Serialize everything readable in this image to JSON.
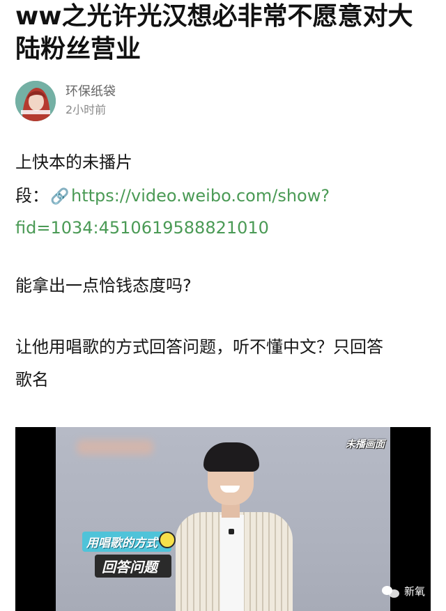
{
  "post": {
    "title": "ww之光许光汉想必非常不愿意对大陆粉丝营业",
    "author": "环保纸袋",
    "time": "2小时前",
    "body": {
      "line1": "上快本的未播片",
      "line2_prefix": "段：",
      "link_part1": "https://video.weibo.com/show?",
      "link_part2": "fid=1034:4510619588821010",
      "line4": "能拿出一点恰钱态度吗?",
      "line5": "让他用唱歌的方式回答问题，听不懂中文？只回答",
      "line6": "歌名"
    }
  },
  "video": {
    "watermark": "未播画面",
    "caption_line1": "用唱歌的方式",
    "caption_line2": "回答问题",
    "corner_label": "新氧"
  },
  "icons": {
    "link": "link-icon",
    "avatar": "avatar-image",
    "corner": "wechat-icon"
  },
  "colors": {
    "link": "#4a9a55",
    "caption_bg": "#4fc3d9"
  }
}
